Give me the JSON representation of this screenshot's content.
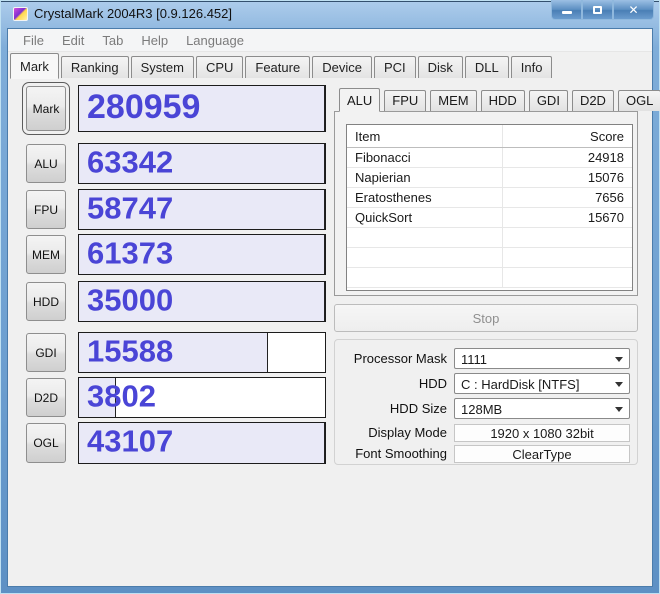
{
  "colors": {
    "score_text": "#4a45d6",
    "score_bg": "#e9e9f7",
    "frame_blue": "#6d9fd0",
    "client_bg": "#f0f0f0"
  },
  "window": {
    "title": "CrystalMark 2004R3 [0.9.126.452]",
    "close_glyph": "✕"
  },
  "menu": {
    "items": [
      "File",
      "Edit",
      "Tab",
      "Help",
      "Language"
    ]
  },
  "main_tabs": {
    "selected": "Mark",
    "items": [
      "Mark",
      "Ranking",
      "System",
      "CPU",
      "Feature",
      "Device",
      "PCI",
      "Disk",
      "DLL",
      "Info"
    ]
  },
  "benchmarks": {
    "rows": [
      {
        "label": "Mark",
        "score": "280959",
        "fill_percent": 100
      },
      {
        "label": "ALU",
        "score": "63342",
        "fill_percent": 100
      },
      {
        "label": "FPU",
        "score": "58747",
        "fill_percent": 100
      },
      {
        "label": "MEM",
        "score": "61373",
        "fill_percent": 100
      },
      {
        "label": "HDD",
        "score": "35000",
        "fill_percent": 100
      },
      {
        "label": "GDI",
        "score": "15588",
        "fill_percent": 77
      },
      {
        "label": "D2D",
        "score": "3802",
        "fill_percent": 15
      },
      {
        "label": "OGL",
        "score": "43107",
        "fill_percent": 100
      }
    ]
  },
  "detail": {
    "selected_tab": "ALU",
    "tabs": [
      "ALU",
      "FPU",
      "MEM",
      "HDD",
      "GDI",
      "D2D",
      "OGL"
    ],
    "table": {
      "columns": [
        "Item",
        "Score"
      ],
      "rows": [
        {
          "item": "Fibonacci",
          "score": "24918"
        },
        {
          "item": "Napierian",
          "score": "15076"
        },
        {
          "item": "Eratosthenes",
          "score": "7656"
        },
        {
          "item": "QuickSort",
          "score": "15670"
        },
        {
          "item": "",
          "score": ""
        },
        {
          "item": "",
          "score": ""
        },
        {
          "item": "",
          "score": ""
        }
      ]
    }
  },
  "controls": {
    "stop_label": "Stop",
    "fields": [
      {
        "label": "Processor Mask",
        "value": "1111",
        "type": "combobox"
      },
      {
        "label": "HDD",
        "value": "C : HardDisk [NTFS]",
        "type": "combobox"
      },
      {
        "label": "HDD Size",
        "value": "128MB",
        "type": "combobox"
      },
      {
        "label": "Display Mode",
        "value": "1920 x 1080 32bit",
        "type": "readonly"
      },
      {
        "label": "Font Smoothing",
        "value": "ClearType",
        "type": "readonly"
      }
    ]
  }
}
